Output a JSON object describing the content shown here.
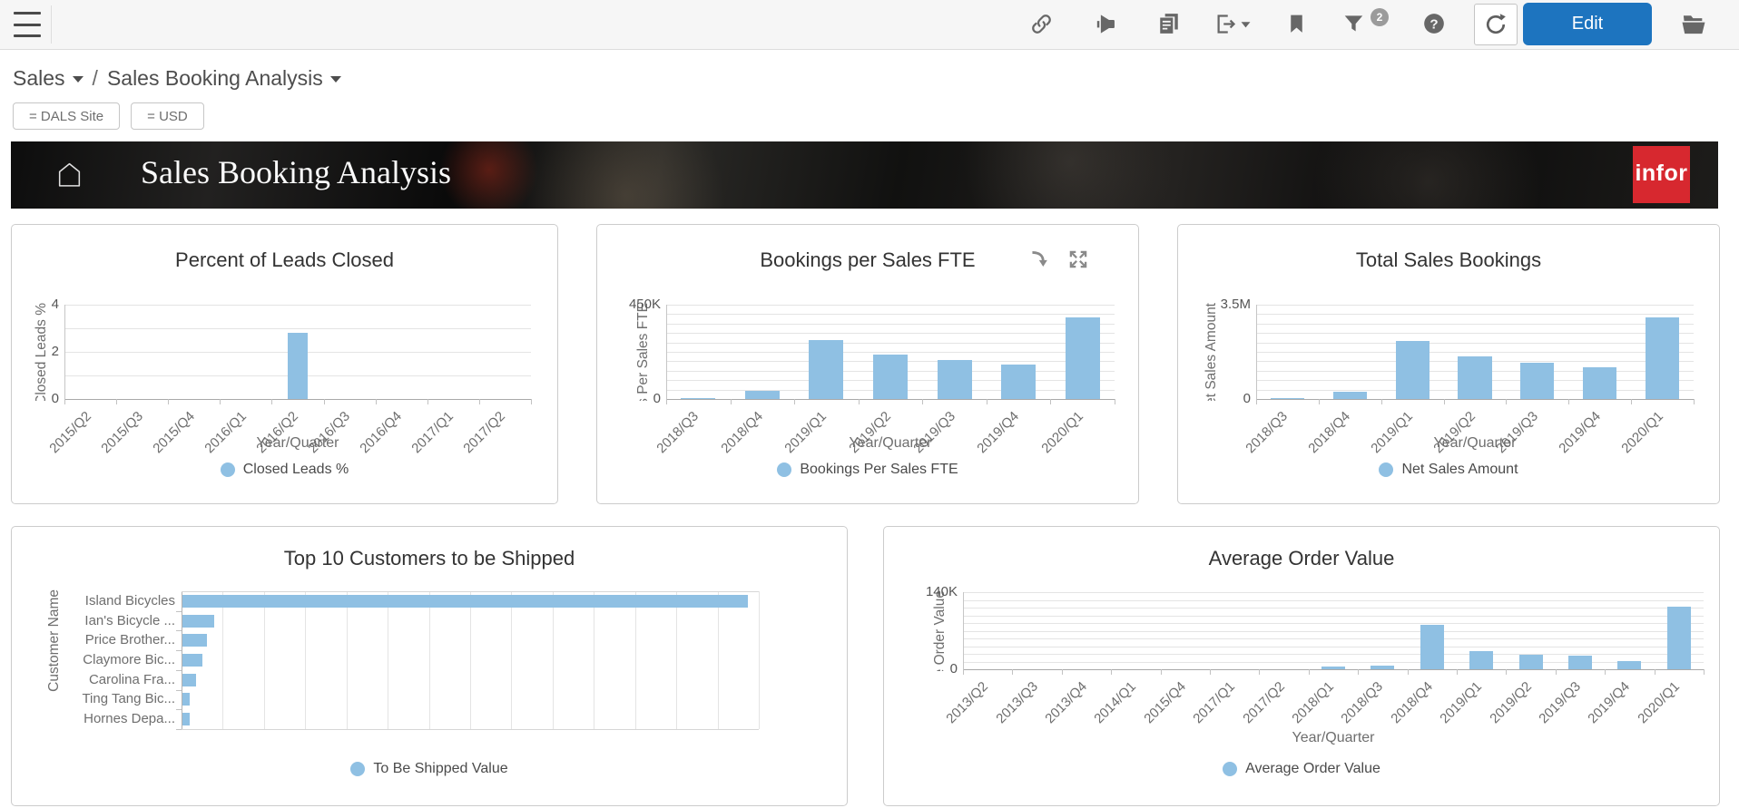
{
  "toolbar": {
    "edit_label": "Edit",
    "filter_badge_count": "2",
    "icons": [
      "link",
      "announce",
      "copy",
      "export",
      "bookmark",
      "filter",
      "help",
      "refresh",
      "folder"
    ]
  },
  "breadcrumb": {
    "level1": "Sales",
    "separator": "/",
    "level2": "Sales Booking Analysis"
  },
  "filters": [
    {
      "label": "= DALS Site"
    },
    {
      "label": "= USD"
    }
  ],
  "banner": {
    "title": "Sales Booking Analysis",
    "logo_text": "infor",
    "logo_color": "#d7282f"
  },
  "colors": {
    "bar_blue": "#8fc0e3",
    "accent_blue": "#1d74bf"
  },
  "charts": [
    {
      "type": "bar",
      "title": "Percent of Leads Closed",
      "xlabel": "Year/Quarter",
      "ylabel": "Closed Leads %",
      "legend": "Closed Leads %",
      "categories": [
        "2015/Q2",
        "2015/Q3",
        "2015/Q4",
        "2016/Q1",
        "2016/Q2",
        "2016/Q3",
        "2016/Q4",
        "2017/Q1",
        "2017/Q2"
      ],
      "values": [
        0,
        0,
        0,
        0,
        2.8,
        0,
        0,
        0,
        0
      ],
      "ylim": [
        0,
        4
      ],
      "grid_divisions": 4,
      "y_ticks": [
        {
          "label": "4",
          "frac": 1
        },
        {
          "label": "2",
          "frac": 0.5
        },
        {
          "label": "0",
          "frac": 0
        }
      ]
    },
    {
      "type": "bar",
      "title": "Bookings per Sales FTE",
      "xlabel": "Year/Quarter",
      "ylabel": "Bookings Per Sales FTE",
      "legend": "Bookings Per Sales FTE",
      "has_drill_and_expand_icons": true,
      "categories": [
        "2018/Q3",
        "2018/Q4",
        "2019/Q1",
        "2019/Q2",
        "2019/Q3",
        "2019/Q4",
        "2020/Q1"
      ],
      "values": [
        4000,
        41000,
        281000,
        210000,
        184000,
        164000,
        388000
      ],
      "ylim": [
        0,
        450000
      ],
      "grid_divisions": 10,
      "y_ticks": [
        {
          "label": "450K",
          "frac": 1
        },
        {
          "label": "0",
          "frac": 0
        }
      ]
    },
    {
      "type": "bar",
      "title": "Total Sales Bookings",
      "xlabel": "Year/Quarter",
      "ylabel": "Net Sales Amount",
      "legend": "Net Sales Amount",
      "categories": [
        "2018/Q3",
        "2018/Q4",
        "2019/Q1",
        "2019/Q2",
        "2019/Q3",
        "2019/Q4",
        "2020/Q1"
      ],
      "values": [
        25000,
        280000,
        2150000,
        1590000,
        1350000,
        1190000,
        3030000
      ],
      "ylim": [
        0,
        3500000
      ],
      "grid_divisions": 10,
      "y_ticks": [
        {
          "label": "3.5M",
          "frac": 1
        },
        {
          "label": "0",
          "frac": 0
        }
      ]
    },
    {
      "type": "bar-horizontal",
      "title": "Top 10 Customers to be Shipped",
      "ylabel": "Customer Name",
      "legend": "To Be Shipped Value",
      "categories": [
        "Island Bicycles",
        "Ian's Bicycle ...",
        "Price Brother...",
        "Claymore Bic...",
        "Carolina Fra...",
        "Ting Tang Bic...",
        "Hornes Depa..."
      ],
      "values": [
        632,
        36,
        27,
        22,
        15,
        8,
        8
      ],
      "value_note": "relative units estimated from bar lengths; no x-axis scale visible",
      "xlim": [
        0,
        645
      ],
      "grid_divisions": 14
    },
    {
      "type": "bar",
      "title": "Average Order Value",
      "xlabel": "Year/Quarter",
      "ylabel": "Average Order Value",
      "legend": "Average Order Value",
      "categories": [
        "2013/Q2",
        "2013/Q3",
        "2013/Q4",
        "2014/Q1",
        "2015/Q4",
        "2017/Q1",
        "2017/Q2",
        "2018/Q1",
        "2018/Q3",
        "2018/Q4",
        "2019/Q1",
        "2019/Q2",
        "2019/Q3",
        "2019/Q4",
        "2020/Q1"
      ],
      "values": [
        0,
        0,
        0,
        0,
        0,
        0,
        0,
        5700,
        7300,
        81000,
        33000,
        26000,
        24000,
        15000,
        114000
      ],
      "ylim": [
        0,
        140000
      ],
      "grid_divisions": 10,
      "y_ticks": [
        {
          "label": "140K",
          "frac": 1
        },
        {
          "label": "0",
          "frac": 0
        }
      ]
    }
  ]
}
